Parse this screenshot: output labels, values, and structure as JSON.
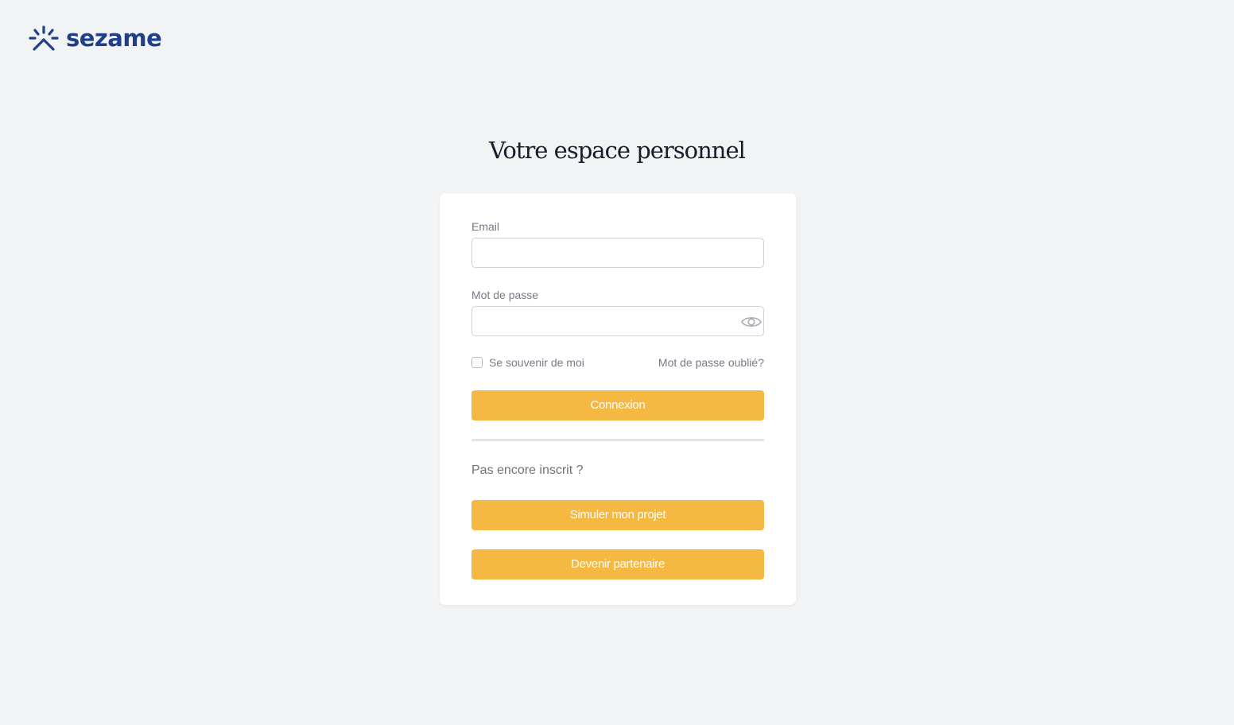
{
  "brand": {
    "name": "sezame",
    "color": "#1f3f8a",
    "logo_icon": "sezame-sunburst-icon"
  },
  "page": {
    "title": "Votre espace personnel"
  },
  "login_form": {
    "email_label": "Email",
    "email_value": "",
    "password_label": "Mot de passe",
    "password_value": "",
    "show_password_icon": "eye-icon",
    "remember_label": "Se souvenir de moi",
    "remember_checked": false,
    "forgot_link": "Mot de passe oublié?",
    "submit_label": "Connexion"
  },
  "signup": {
    "prompt": "Pas encore inscrit ?",
    "simulate_label": "Simuler mon projet",
    "partner_label": "Devenir partenaire"
  },
  "colors": {
    "background": "#f2f3f5",
    "button": "#f4b843",
    "card": "#ffffff"
  }
}
